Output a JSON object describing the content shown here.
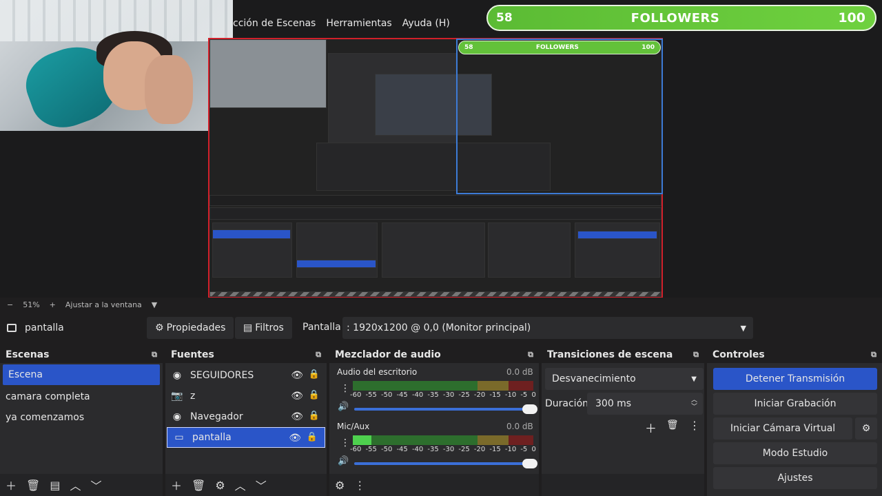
{
  "menu": [
    "cción de Escenas",
    "Herramientas",
    "Ayuda (H)"
  ],
  "overlay": {
    "current": "58",
    "label": "FOLLOWERS",
    "goal": "100"
  },
  "nested_overlay": {
    "current": "58",
    "label": "FOLLOWERS",
    "goal": "100"
  },
  "zoom": {
    "minus": "−",
    "value": "51%",
    "plus": "+",
    "fit": "Ajustar a la ventana"
  },
  "source_toolbar": {
    "name": "pantalla",
    "properties": "Propiedades",
    "filters": "Filtros",
    "display_label": "Pantalla",
    "monitor": ": 1920x1200 @ 0,0 (Monitor principal)"
  },
  "scenes": {
    "title": "Escenas",
    "items": [
      "Escena",
      "camara completa",
      "ya comenzamos"
    ],
    "selected": 0
  },
  "sources": {
    "title": "Fuentes",
    "items": [
      "SEGUIDORES",
      "z",
      "Navegador",
      "pantalla"
    ],
    "icons": [
      "browser-icon",
      "camera-icon",
      "browser-icon",
      "monitor-icon"
    ],
    "selected": 3
  },
  "mixer": {
    "title": "Mezclador de audio",
    "channels": [
      {
        "name": "Audio del escritorio",
        "db": "0.0 dB",
        "level": 0.0
      },
      {
        "name": "Mic/Aux",
        "db": "0.0 dB",
        "level": 0.15
      }
    ],
    "scale": [
      "-60",
      "-55",
      "-50",
      "-45",
      "-40",
      "-35",
      "-30",
      "-25",
      "-20",
      "-15",
      "-10",
      "-5",
      "0"
    ]
  },
  "transitions": {
    "title": "Transiciones de escena",
    "type": "Desvanecimiento",
    "duration_label": "Duración",
    "duration_value": "300 ms"
  },
  "controls": {
    "title": "Controles",
    "buttons": [
      "Detener Transmisión",
      "Iniciar Grabación",
      "Iniciar Cámara Virtual",
      "Modo Estudio",
      "Ajustes"
    ]
  },
  "colors": {
    "accent": "#2a55c8",
    "recording": "#d2202a",
    "followers": "#63c13a"
  }
}
